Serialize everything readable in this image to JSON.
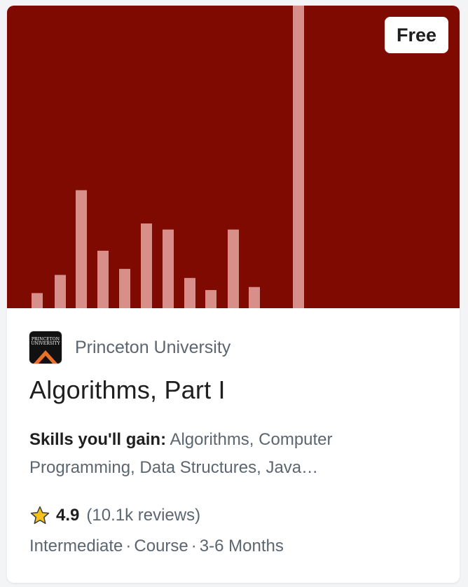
{
  "card": {
    "badge": "Free",
    "partner": {
      "name": "Princeton University",
      "logo_text_line1": "PRINCETON",
      "logo_text_line2": "UNIVERSITY",
      "logo_colors": {
        "background": "#111111",
        "accent": "#e8712a"
      }
    },
    "title": "Algorithms, Part I",
    "skills_label": "Skills you'll gain:",
    "skills_text": "Algorithms, Computer Programming, Data Structures, Java…",
    "rating": "4.9",
    "reviews": "(10.1k reviews)",
    "level": "Intermediate",
    "type": "Course",
    "duration": "3-6 Months",
    "separator": "·",
    "banner": {
      "background": "#7e0a02",
      "bar_color": "#d88f89",
      "bar_levels": [
        0.05,
        0.11,
        0.39,
        0.19,
        0.13,
        0.28,
        0.26,
        0.1,
        0.06,
        0.26,
        0.07,
        1.0
      ]
    },
    "icons": {
      "rating": "star-icon"
    }
  }
}
